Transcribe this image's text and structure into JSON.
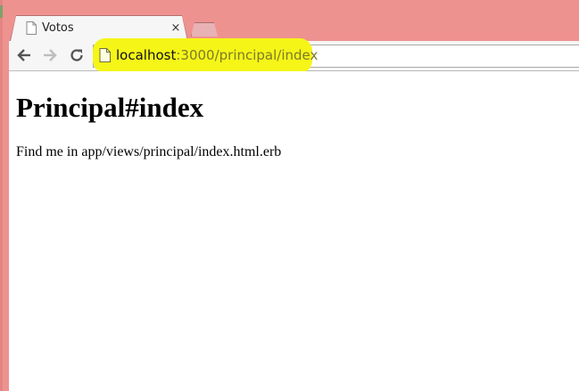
{
  "browser": {
    "tab": {
      "title": "Votos",
      "close_glyph": "×",
      "icon": "page-icon"
    },
    "nav": {
      "back_icon": "back-arrow-icon",
      "forward_icon": "forward-arrow-icon",
      "reload_icon": "reload-icon"
    },
    "address": {
      "host": "localhost",
      "rest": ":3000/principal/index"
    }
  },
  "page": {
    "heading": "Principal#index",
    "paragraph": "Find me in app/views/principal/index.html.erb"
  },
  "colors": {
    "frame": "#ee9290",
    "highlight": "#f5f518",
    "url_rest": "#7d7a2a"
  }
}
